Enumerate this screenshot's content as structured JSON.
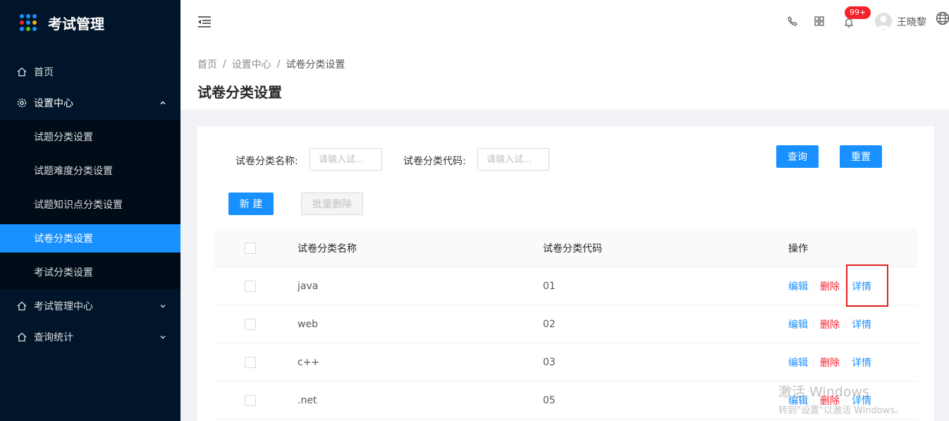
{
  "app": {
    "title": "考试管理",
    "logo_dot_colors": [
      "#1890ff",
      "#1890ff",
      "#1890ff",
      "#f5222d",
      "#1890ff",
      "#faad14",
      "#1890ff",
      "#52c41a",
      "#1890ff"
    ]
  },
  "sidebar": {
    "items": [
      {
        "label": "首页",
        "icon": "home-icon"
      },
      {
        "label": "设置中心",
        "icon": "gear-icon",
        "expanded": true
      },
      {
        "label": "考试管理中心",
        "icon": "home-icon"
      },
      {
        "label": "查询统计",
        "icon": "home-icon"
      }
    ],
    "settings_children": [
      {
        "label": "试题分类设置"
      },
      {
        "label": "试题难度分类设置"
      },
      {
        "label": "试题知识点分类设置"
      },
      {
        "label": "试卷分类设置",
        "active": true
      },
      {
        "label": "考试分类设置"
      }
    ]
  },
  "header": {
    "notification_count": "99+",
    "username": "王晓黎"
  },
  "breadcrumb": [
    "首页",
    "设置中心",
    "试卷分类设置"
  ],
  "page_title": "试卷分类设置",
  "search_form": {
    "name_label": "试卷分类名称:",
    "name_placeholder": "请输入试...",
    "code_label": "试卷分类代码:",
    "code_placeholder": "请输入试...",
    "query_button": "查询",
    "reset_button": "重置"
  },
  "toolbar": {
    "new_button": "新 建",
    "batch_delete_button": "批量删除"
  },
  "table": {
    "columns": [
      "试卷分类名称",
      "试卷分类代码",
      "操作"
    ],
    "rows": [
      {
        "name": "java",
        "code": "01"
      },
      {
        "name": "web",
        "code": "02"
      },
      {
        "name": "c++",
        "code": "03"
      },
      {
        "name": ".net",
        "code": "05"
      }
    ],
    "actions": {
      "edit": "编辑",
      "delete": "删除",
      "detail": "详情"
    }
  },
  "watermark": {
    "line1": "激活 Windows",
    "line2": "转到\"设置\"以激活 Windows。"
  }
}
